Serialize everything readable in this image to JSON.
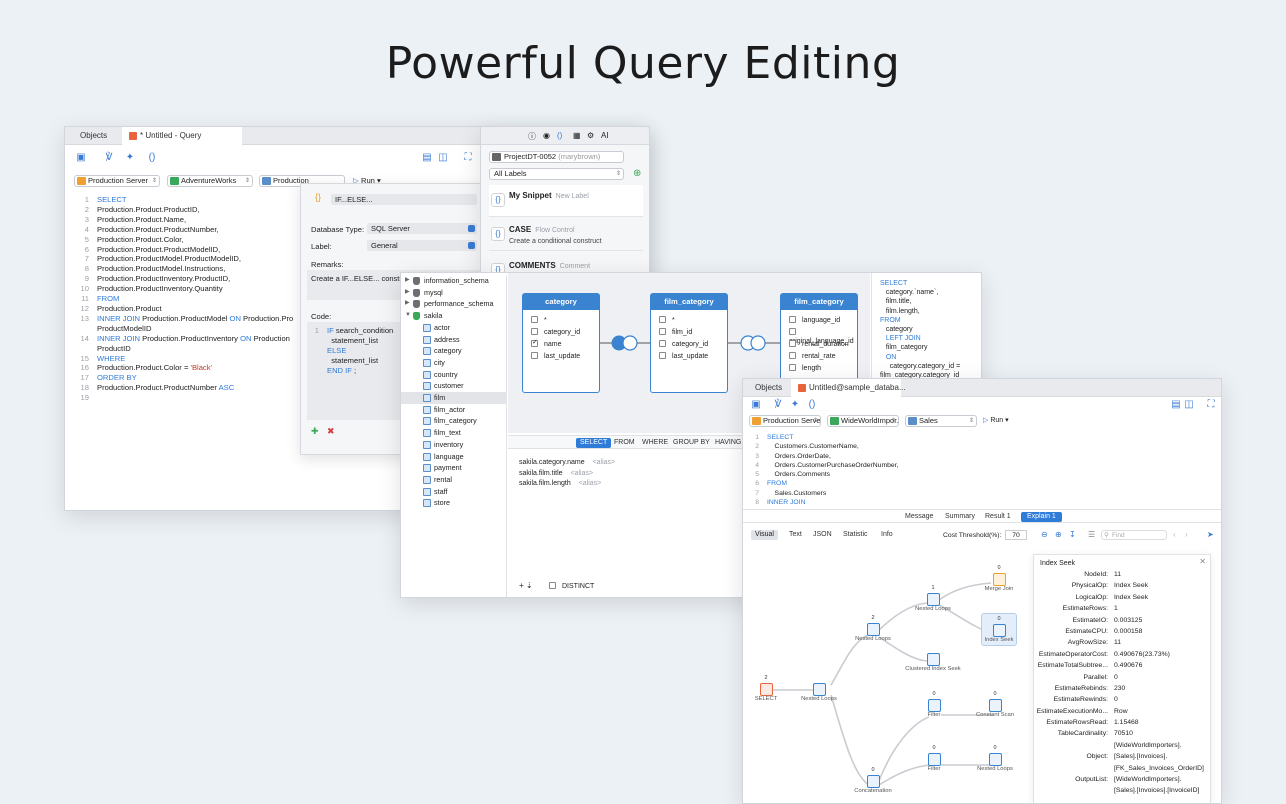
{
  "headline": "Powerful Query Editing",
  "win1": {
    "tabs": [
      "Objects",
      "* Untitled - Query"
    ],
    "connection": "Production Server",
    "database": "AdventureWorks",
    "schema": "Production",
    "run_label": "Run",
    "code_lines": [
      {
        "n": "1",
        "parts": [
          [
            "kw",
            "SELECT"
          ]
        ]
      },
      {
        "n": "2",
        "parts": [
          [
            "",
            "Production.Product.ProductID,"
          ]
        ]
      },
      {
        "n": "3",
        "parts": [
          [
            "",
            "Production.Product.Name,"
          ]
        ]
      },
      {
        "n": "4",
        "parts": [
          [
            "",
            "Production.Product.ProductNumber,"
          ]
        ]
      },
      {
        "n": "5",
        "parts": [
          [
            "",
            "Production.Product.Color,"
          ]
        ]
      },
      {
        "n": "6",
        "parts": [
          [
            "",
            "Production.Product.ProductModelID,"
          ]
        ]
      },
      {
        "n": "7",
        "parts": [
          [
            "",
            "Production.ProductModel.ProductModelID,"
          ]
        ]
      },
      {
        "n": "8",
        "parts": [
          [
            "",
            "Production.ProductModel.Instructions,"
          ]
        ]
      },
      {
        "n": "9",
        "parts": [
          [
            "",
            "Production.ProductInventory.ProductID,"
          ]
        ]
      },
      {
        "n": "10",
        "parts": [
          [
            "",
            "Production.ProductInventory.Quantity"
          ]
        ]
      },
      {
        "n": "11",
        "parts": [
          [
            "kw",
            "FROM"
          ]
        ]
      },
      {
        "n": "12",
        "parts": [
          [
            "",
            "Production.Product"
          ]
        ]
      },
      {
        "n": "13",
        "parts": [
          [
            "kw",
            "INNER JOIN"
          ],
          [
            "",
            " Production.ProductModel "
          ],
          [
            "kw",
            "ON"
          ],
          [
            "",
            " Production.Pro"
          ]
        ]
      },
      {
        "n": "",
        "parts": [
          [
            "",
            "ProductModelID"
          ]
        ]
      },
      {
        "n": "14",
        "parts": [
          [
            "kw",
            "INNER JOIN"
          ],
          [
            "",
            " Production.ProductInventory "
          ],
          [
            "kw",
            "ON"
          ],
          [
            "",
            " Production"
          ]
        ]
      },
      {
        "n": "",
        "parts": [
          [
            "",
            "ProductID"
          ]
        ]
      },
      {
        "n": "15",
        "parts": [
          [
            "kw",
            "WHERE"
          ]
        ]
      },
      {
        "n": "16",
        "parts": [
          [
            "",
            "Production.Product.Color = "
          ],
          [
            "str",
            "'Black'"
          ]
        ]
      },
      {
        "n": "17",
        "parts": [
          [
            "kw",
            "ORDER BY"
          ]
        ]
      },
      {
        "n": "18",
        "parts": [
          [
            "",
            "Production.Product.ProductNumber "
          ],
          [
            "kw",
            "ASC"
          ]
        ]
      },
      {
        "n": "19",
        "parts": []
      }
    ]
  },
  "snippet_editor": {
    "name": "IF...ELSE...",
    "db_type_label": "Database Type:",
    "db_type": "SQL Server",
    "label_label": "Label:",
    "label_value": "General",
    "remarks_label": "Remarks:",
    "remarks": "Create a IF...ELSE... constr",
    "code_label": "Code:",
    "code_lines": [
      {
        "n": "1",
        "parts": [
          [
            "kw",
            "IF"
          ],
          [
            "",
            " search_condition"
          ]
        ]
      },
      {
        "n": "",
        "parts": [
          [
            "",
            "  statement_list"
          ]
        ]
      },
      {
        "n": "",
        "parts": [
          [
            "kw",
            "ELSE"
          ]
        ]
      },
      {
        "n": "",
        "parts": [
          [
            "",
            "  statement_list"
          ]
        ]
      },
      {
        "n": "",
        "parts": [
          [
            "kw",
            "END IF"
          ],
          [
            "",
            " ;"
          ]
        ]
      }
    ]
  },
  "snippets_panel": {
    "project": "ProjectDT-0052",
    "user": "(marybrown)",
    "labels": "All Labels",
    "items": [
      {
        "title": "My Snippet",
        "tag": "New Label",
        "desc": ""
      },
      {
        "title": "CASE",
        "tag": "Flow Control",
        "desc": "Create a conditional construct"
      },
      {
        "title": "COMMENTS",
        "tag": "Comment",
        "desc": ""
      }
    ]
  },
  "builder": {
    "tree": [
      {
        "label": "information_schema",
        "type": "db"
      },
      {
        "label": "mysql",
        "type": "db"
      },
      {
        "label": "performance_schema",
        "type": "db"
      },
      {
        "label": "sakila",
        "type": "db"
      },
      {
        "label": "actor",
        "type": "tbl"
      },
      {
        "label": "address",
        "type": "tbl"
      },
      {
        "label": "category",
        "type": "tbl"
      },
      {
        "label": "city",
        "type": "tbl"
      },
      {
        "label": "country",
        "type": "tbl"
      },
      {
        "label": "customer",
        "type": "tbl"
      },
      {
        "label": "film",
        "type": "tbl"
      },
      {
        "label": "film_actor",
        "type": "tbl"
      },
      {
        "label": "film_category",
        "type": "tbl"
      },
      {
        "label": "film_text",
        "type": "tbl"
      },
      {
        "label": "inventory",
        "type": "tbl"
      },
      {
        "label": "language",
        "type": "tbl"
      },
      {
        "label": "payment",
        "type": "tbl"
      },
      {
        "label": "rental",
        "type": "tbl"
      },
      {
        "label": "staff",
        "type": "tbl"
      },
      {
        "label": "store",
        "type": "tbl"
      }
    ],
    "entities": [
      {
        "name": "category",
        "fields": [
          [
            "*",
            false
          ],
          [
            "category_id",
            false
          ],
          [
            "name",
            true
          ],
          [
            "last_update",
            false
          ]
        ]
      },
      {
        "name": "film_category",
        "fields": [
          [
            "*",
            false
          ],
          [
            "film_id",
            false
          ],
          [
            "category_id",
            false
          ],
          [
            "last_update",
            false
          ]
        ]
      },
      {
        "name": "film_category",
        "fields": [
          [
            "language_id",
            false
          ],
          [
            "original_language_id",
            false
          ],
          [
            "rental_duration",
            false
          ],
          [
            "rental_rate",
            false
          ],
          [
            "length",
            false
          ]
        ]
      }
    ],
    "clause_tabs": [
      "SELECT",
      "FROM",
      "WHERE",
      "GROUP BY",
      "HAVING"
    ],
    "select_rows": [
      {
        "col": "sakila.category.name",
        "alias": "<alias>"
      },
      {
        "col": "sakila.film.title",
        "alias": "<alias>"
      },
      {
        "col": "sakila.film.length",
        "alias": "<alias>"
      }
    ],
    "distinct": "DISTINCT",
    "sql_preview": [
      [
        "kw",
        "SELECT"
      ],
      [
        "",
        "   category.`name`,"
      ],
      [
        "",
        "   film.title,"
      ],
      [
        "",
        "   film.length,"
      ],
      [
        "kw",
        "FROM"
      ],
      [
        "",
        "   category"
      ],
      [
        "kw",
        "   LEFT JOIN"
      ],
      [
        "",
        "   film_category"
      ],
      [
        "kw",
        "   ON"
      ],
      [
        "",
        "     category.category_id ="
      ],
      [
        "",
        "film_category.category_id"
      ]
    ]
  },
  "win3": {
    "tabs": [
      "Objects",
      "Untitled@sample_databa..."
    ],
    "connection": "Production Server",
    "database": "WideWorldImpor...",
    "schema": "Sales",
    "run_label": "Run",
    "code_lines": [
      {
        "n": "1",
        "parts": [
          [
            "kw",
            "SELECT"
          ]
        ]
      },
      {
        "n": "2",
        "parts": [
          [
            "",
            "    Customers.CustomerName,"
          ]
        ]
      },
      {
        "n": "3",
        "parts": [
          [
            "",
            "    Orders.OrderDate,"
          ]
        ]
      },
      {
        "n": "4",
        "parts": [
          [
            "",
            "    Orders.CustomerPurchaseOrderNumber,"
          ]
        ]
      },
      {
        "n": "5",
        "parts": [
          [
            "",
            "    Orders.Comments"
          ]
        ]
      },
      {
        "n": "6",
        "parts": [
          [
            "kw",
            "FROM"
          ]
        ]
      },
      {
        "n": "7",
        "parts": [
          [
            "",
            "    Sales.Customers"
          ]
        ]
      },
      {
        "n": "8",
        "parts": [
          [
            "kw",
            "INNER JOIN"
          ]
        ]
      }
    ],
    "result_tabs": [
      "Message",
      "Summary",
      "Result 1",
      "Explain 1"
    ],
    "view_tabs": [
      "Visual",
      "Text",
      "JSON",
      "Statistic",
      "Info"
    ],
    "cost_label": "Cost Threshold(%):",
    "cost_value": "70",
    "find_placeholder": "Find",
    "props_title": "Index Seek",
    "props": [
      [
        "NodeId:",
        "11"
      ],
      [
        "PhysicalOp:",
        "Index Seek"
      ],
      [
        "LogicalOp:",
        "Index Seek"
      ],
      [
        "EstimateRows:",
        "1"
      ],
      [
        "EstimateIO:",
        "0.003125"
      ],
      [
        "EstimateCPU:",
        "0.000158"
      ],
      [
        "AvgRowSize:",
        "11"
      ],
      [
        "EstimateOperatorCost:",
        "0.490676(23.73%)"
      ],
      [
        "EstimateTotalSubtree...",
        "0.490676"
      ],
      [
        "Parallel:",
        "0"
      ],
      [
        "EstimateRebinds:",
        "230"
      ],
      [
        "EstimateRewinds:",
        "0"
      ],
      [
        "EstimateExecutionMo...",
        "Row"
      ],
      [
        "EstimateRowsRead:",
        "1.15468"
      ],
      [
        "TableCardinality:",
        "70510"
      ],
      [
        "",
        "[WideWorldImporters]."
      ],
      [
        "Object:",
        "[Sales].[Invoices]."
      ],
      [
        "",
        "[FK_Sales_Invoices_OrderID]"
      ],
      [
        "OutputList:",
        "[WideWorldImporters]."
      ],
      [
        "",
        "[Sales].[Invoices].[InvoiceID]"
      ]
    ],
    "plan_nodes": [
      {
        "label": "SELECT",
        "count": "2"
      },
      {
        "label": "Nested Loops",
        "count": ""
      },
      {
        "label": "Nested Loops",
        "count": "2"
      },
      {
        "label": "Nested Loops",
        "count": "1"
      },
      {
        "label": "Merge Join",
        "count": "0"
      },
      {
        "label": "Index Seek",
        "count": "0"
      },
      {
        "label": "Clustered Index Seek",
        "count": ""
      },
      {
        "label": "Filter",
        "count": "0"
      },
      {
        "label": "Constant Scan",
        "count": "0"
      },
      {
        "label": "Filter",
        "count": "0"
      },
      {
        "label": "Nested Loops",
        "count": "0"
      },
      {
        "label": "Concatenation",
        "count": "0"
      }
    ]
  }
}
